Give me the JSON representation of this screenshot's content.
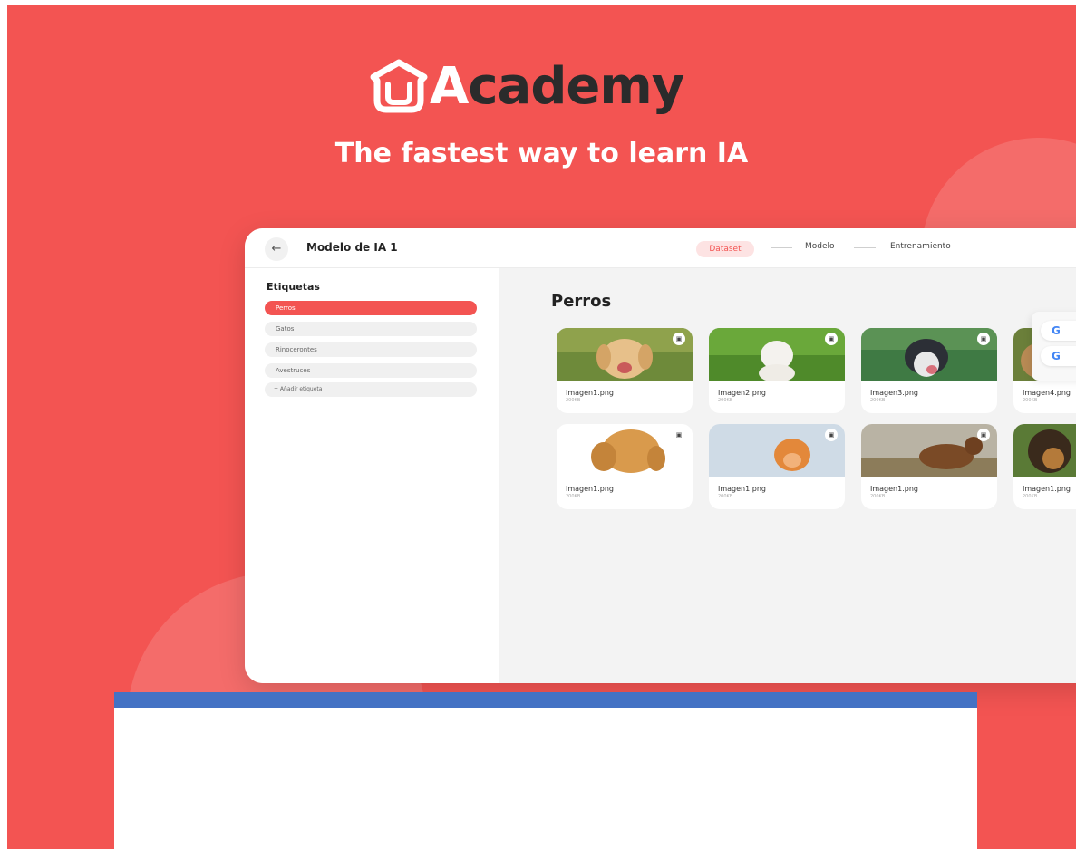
{
  "brand": {
    "logo_a": "A",
    "logo_rest": "cademy",
    "tagline": "The fastest way to learn IA"
  },
  "header": {
    "back_icon": "arrow-left-icon",
    "title": "Modelo de IA 1",
    "steps": [
      "Dataset",
      "Modelo",
      "Entrenamiento"
    ]
  },
  "sidebar": {
    "title": "Etiquetas",
    "items": [
      "Perros",
      "Gatos",
      "Rinocerontes",
      "Avestruces"
    ],
    "add_label": "+   Añadir etiqueta"
  },
  "main": {
    "title": "Perros",
    "cards": [
      {
        "name": "Imagen1.png",
        "size": "200KB"
      },
      {
        "name": "Imagen2.png",
        "size": "200KB"
      },
      {
        "name": "Imagen3.png",
        "size": "200KB"
      },
      {
        "name": "Imagen4.png",
        "size": "200KB"
      },
      {
        "name": "Imagen1.png",
        "size": "200KB"
      },
      {
        "name": "Imagen1.png",
        "size": "200KB"
      },
      {
        "name": "Imagen1.png",
        "size": "200KB"
      },
      {
        "name": "Imagen1.png",
        "size": "200KB"
      }
    ],
    "delete_icon": "trash-icon"
  },
  "google_popup": {
    "letter": "G"
  },
  "colors": {
    "brand_red": "#f35452",
    "accent_blue": "#4472c4",
    "dark": "#2b2b2b"
  }
}
